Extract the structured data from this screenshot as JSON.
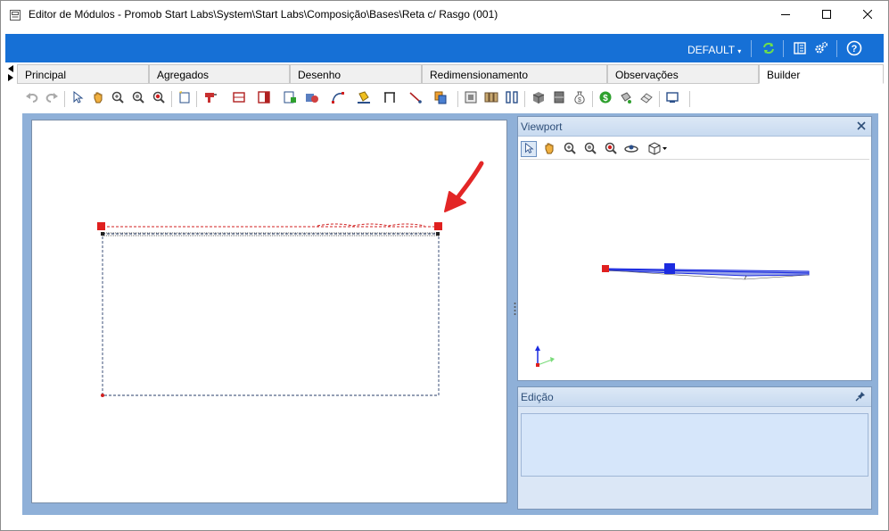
{
  "window": {
    "title": "Editor de Módulos - Promob Start Labs\\System\\Start Labs\\Composição\\Bases\\Reta c/ Rasgo (001)",
    "controls": [
      "minimize-icon",
      "maximize-icon",
      "close-icon"
    ]
  },
  "topbar": {
    "profile_label": "DEFAULT",
    "icons": [
      "refresh-icon",
      "library-icon",
      "settings-icon",
      "help-icon"
    ],
    "accent_color": "#1670d6"
  },
  "tabs": [
    {
      "label": "Principal",
      "active": false
    },
    {
      "label": "Agregados",
      "active": false
    },
    {
      "label": "Desenho",
      "active": false
    },
    {
      "label": "Redimensionamento",
      "active": false
    },
    {
      "label": "Observações",
      "active": false
    },
    {
      "label": "Builder",
      "active": true
    }
  ],
  "toolbar": {
    "icons": [
      "undo-icon",
      "redo-icon",
      "select-icon",
      "pan-icon",
      "zoom-extents-icon",
      "zoom-in-icon",
      "zoom-window-icon",
      "new-icon",
      "drill-icon",
      "panel-icon",
      "frame-icon",
      "insert-icon",
      "material-icon",
      "curve-icon",
      "fill-icon",
      "dimension-icon",
      "line-icon",
      "copy-icon",
      "view-icon",
      "grid-icon",
      "columns-icon",
      "box-icon",
      "cabinet-icon",
      "money-bag-icon",
      "price-icon",
      "paint-icon",
      "eraser-icon",
      "display-icon"
    ]
  },
  "viewport": {
    "title": "Viewport",
    "toolbar_icons": [
      "select-icon",
      "pan-icon",
      "zoom-extents-icon",
      "zoom-in-icon",
      "zoom-window-icon",
      "orbit-icon",
      "cube-view-icon"
    ]
  },
  "edicao": {
    "title": "Edição"
  },
  "colors": {
    "handle": "#e0201f",
    "annotation_arrow": "#e32626",
    "viewport_selection": "#1b2be0",
    "workspace": "#8fb0d8"
  }
}
